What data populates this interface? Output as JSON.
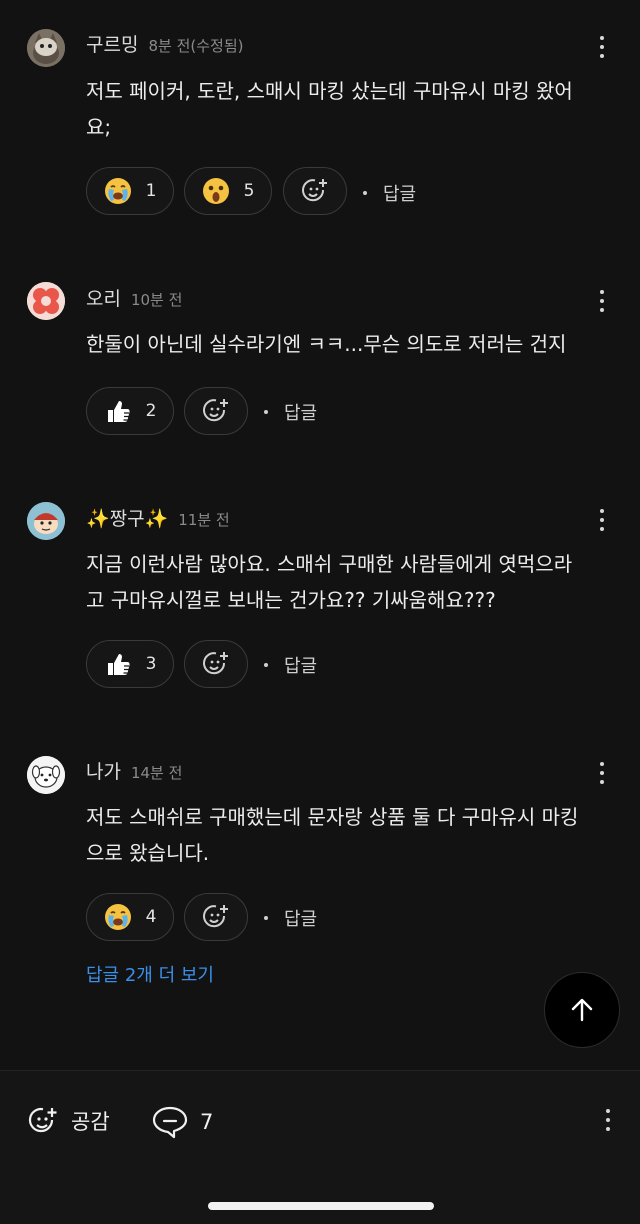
{
  "comments": [
    {
      "author": "구르밍",
      "time": "8분 전(수정됨)",
      "text_lines": [
        "저도 페이커, 도란, 스매시 마킹 샀는데 구마유시 마킹 왔어",
        "요;"
      ],
      "reactions": [
        {
          "icon": "crying-face-icon",
          "count": "1"
        },
        {
          "icon": "shocked-face-icon",
          "count": "5"
        }
      ],
      "reply_label": "답글"
    },
    {
      "author": "오리",
      "time": "10분 전",
      "text_lines": [
        "한둘이 아닌데 실수라기엔 ㅋㅋ...무슨 의도로 저러는 건지"
      ],
      "reactions": [
        {
          "icon": "thumbs-up-icon",
          "count": "2"
        }
      ],
      "reply_label": "답글"
    },
    {
      "author": "✨짱구✨",
      "time": "11분 전",
      "text_lines": [
        "지금 이런사람 많아요. 스매쉬 구매한 사람들에게 엿먹으라",
        "고 구마유시껄로 보내는 건가요?? 기싸움해요???"
      ],
      "reactions": [
        {
          "icon": "thumbs-up-icon",
          "count": "3"
        }
      ],
      "reply_label": "답글"
    },
    {
      "author": "나가",
      "time": "14분 전",
      "text_lines": [
        "저도 스매쉬로 구매했는데 문자랑 상품 둘 다 구마유시 마킹",
        "으로 왔습니다."
      ],
      "reactions": [
        {
          "icon": "crying-face-icon",
          "count": "4"
        }
      ],
      "reply_label": "답글",
      "more_replies": "답글 2개 더 보기"
    }
  ],
  "bottom_bar": {
    "like_label": "공감",
    "comment_count": "7"
  },
  "colors": {
    "background": "#121212",
    "link_blue": "#3b8fe8",
    "emoji_yellow": "#f5c242"
  }
}
